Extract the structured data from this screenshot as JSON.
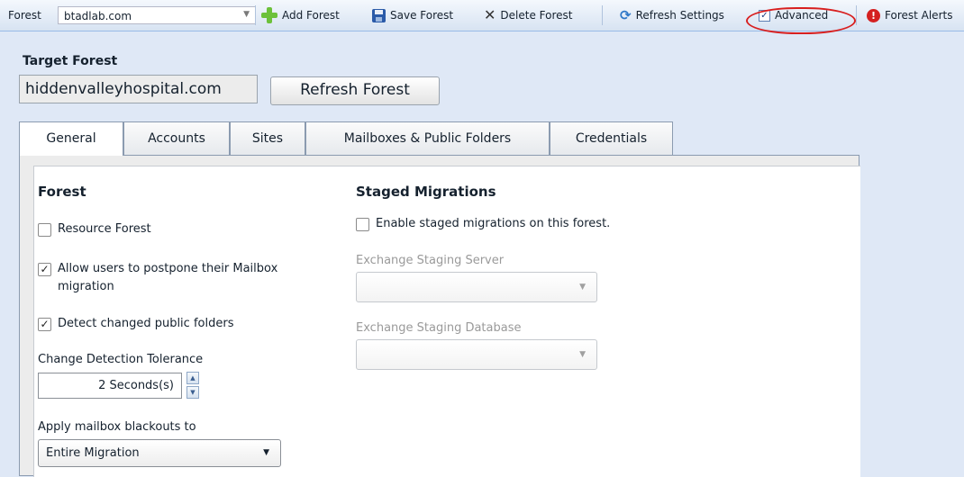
{
  "toolbar": {
    "forest_label": "Forest",
    "forest_value": "btadlab.com",
    "add_label": "Add Forest",
    "save_label": "Save Forest",
    "delete_label": "Delete Forest",
    "refresh_label": "Refresh Settings",
    "advanced_label": "Advanced",
    "advanced_checked": true,
    "alerts_label": "Forest Alerts"
  },
  "target": {
    "heading": "Target Forest",
    "value": "hiddenvalleyhospital.com",
    "refresh_button": "Refresh Forest"
  },
  "tabs": [
    "General",
    "Accounts",
    "Sites",
    "Mailboxes & Public Folders",
    "Credentials"
  ],
  "active_tab": "General",
  "forest": {
    "heading": "Forest",
    "resource_forest": {
      "label": "Resource Forest",
      "checked": false
    },
    "allow_postpone": {
      "label_line1": "Allow users to postpone their Mailbox",
      "label_line2": "migration",
      "checked": true
    },
    "detect_changed": {
      "label": "Detect changed public folders",
      "checked": true
    },
    "tolerance_label": "Change Detection Tolerance",
    "tolerance_value": "2 Seconds(s)",
    "blackouts_label": "Apply mailbox blackouts to",
    "blackouts_value": "Entire Migration"
  },
  "staged": {
    "heading": "Staged Migrations",
    "enable": {
      "label": "Enable staged migrations on this forest.",
      "checked": false
    },
    "server_label": "Exchange Staging Server",
    "server_value": "",
    "database_label": "Exchange Staging Database",
    "database_value": ""
  }
}
